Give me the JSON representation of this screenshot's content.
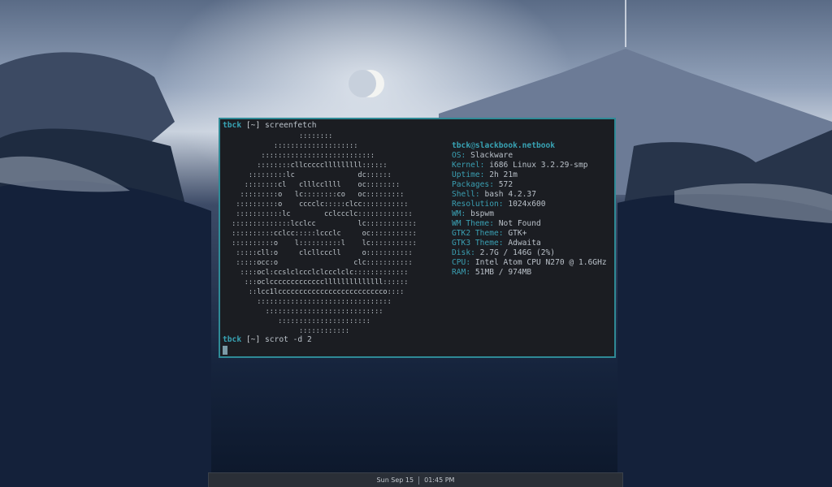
{
  "terminal": {
    "prompt": {
      "user": "tbck",
      "path": "[~]"
    },
    "commands": [
      "screenfetch",
      "scrot -d 2"
    ],
    "ascii_art": [
      "                 ::::::::",
      "           ::::::::::::::::::::",
      "        :::::::::::::::::::::::::::",
      "       ::::::::cllccccclllllllll::::::",
      "     :::::::::lc               dc::::::",
      "    ::::::::cl   clllccllll    oc::::::::",
      "   :::::::::o   lc::::::::co   oc:::::::::",
      "  ::::::::::o    cccclc:::::clcc:::::::::::",
      "  :::::::::::lc        cclccclc:::::::::::::",
      " ::::::::::::::lcclcc          lc::::::::::::",
      " ::::::::::cclcc:::::lccclc     oc:::::::::::",
      " ::::::::::o    l::::::::::l    lc:::::::::::",
      "  :::::cll:o     clcllcccll     o:::::::::::",
      "  :::::occ:o                  clc:::::::::::",
      "   ::::ocl:ccslclccclclccclclc:::::::::::::",
      "    :::oclcccccccccccccllllllllllllll::::::",
      "     ::lcc1lccccccccccccccccccccccccco::::",
      "       ::::::::::::::::::::::::::::::::",
      "         ::::::::::::::::::::::::::::",
      "            ::::::::::::::::::::::",
      "                 ::::::::::::"
    ],
    "host": {
      "user": "tbck",
      "at": "@",
      "name": "slackbook.netbook"
    },
    "info": [
      {
        "key": "OS:",
        "value": "Slackware"
      },
      {
        "key": "Kernel:",
        "value": "i686 Linux 3.2.29-smp"
      },
      {
        "key": "Uptime:",
        "value": "2h 21m"
      },
      {
        "key": "Packages:",
        "value": "572"
      },
      {
        "key": "Shell:",
        "value": "bash 4.2.37"
      },
      {
        "key": "Resolution:",
        "value": "1024x600"
      },
      {
        "key": "WM:",
        "value": "bspwm"
      },
      {
        "key": "WM Theme:",
        "value": "Not Found"
      },
      {
        "key": "GTK2 Theme:",
        "value": "GTK+"
      },
      {
        "key": "GTK3 Theme:",
        "value": "Adwaita"
      },
      {
        "key": "Disk:",
        "value": "2.7G / 146G (2%)"
      },
      {
        "key": "CPU:",
        "value": "Intel Atom CPU N270 @ 1.6GHz"
      },
      {
        "key": "RAM:",
        "value": "51MB / 974MB"
      }
    ]
  },
  "statusbar": {
    "date": "Sun Sep 15",
    "time": "01:45 PM"
  },
  "colors": {
    "accent": "#38a3b4",
    "border": "#2f8a96",
    "terminal_bg": "#1b1d22"
  }
}
